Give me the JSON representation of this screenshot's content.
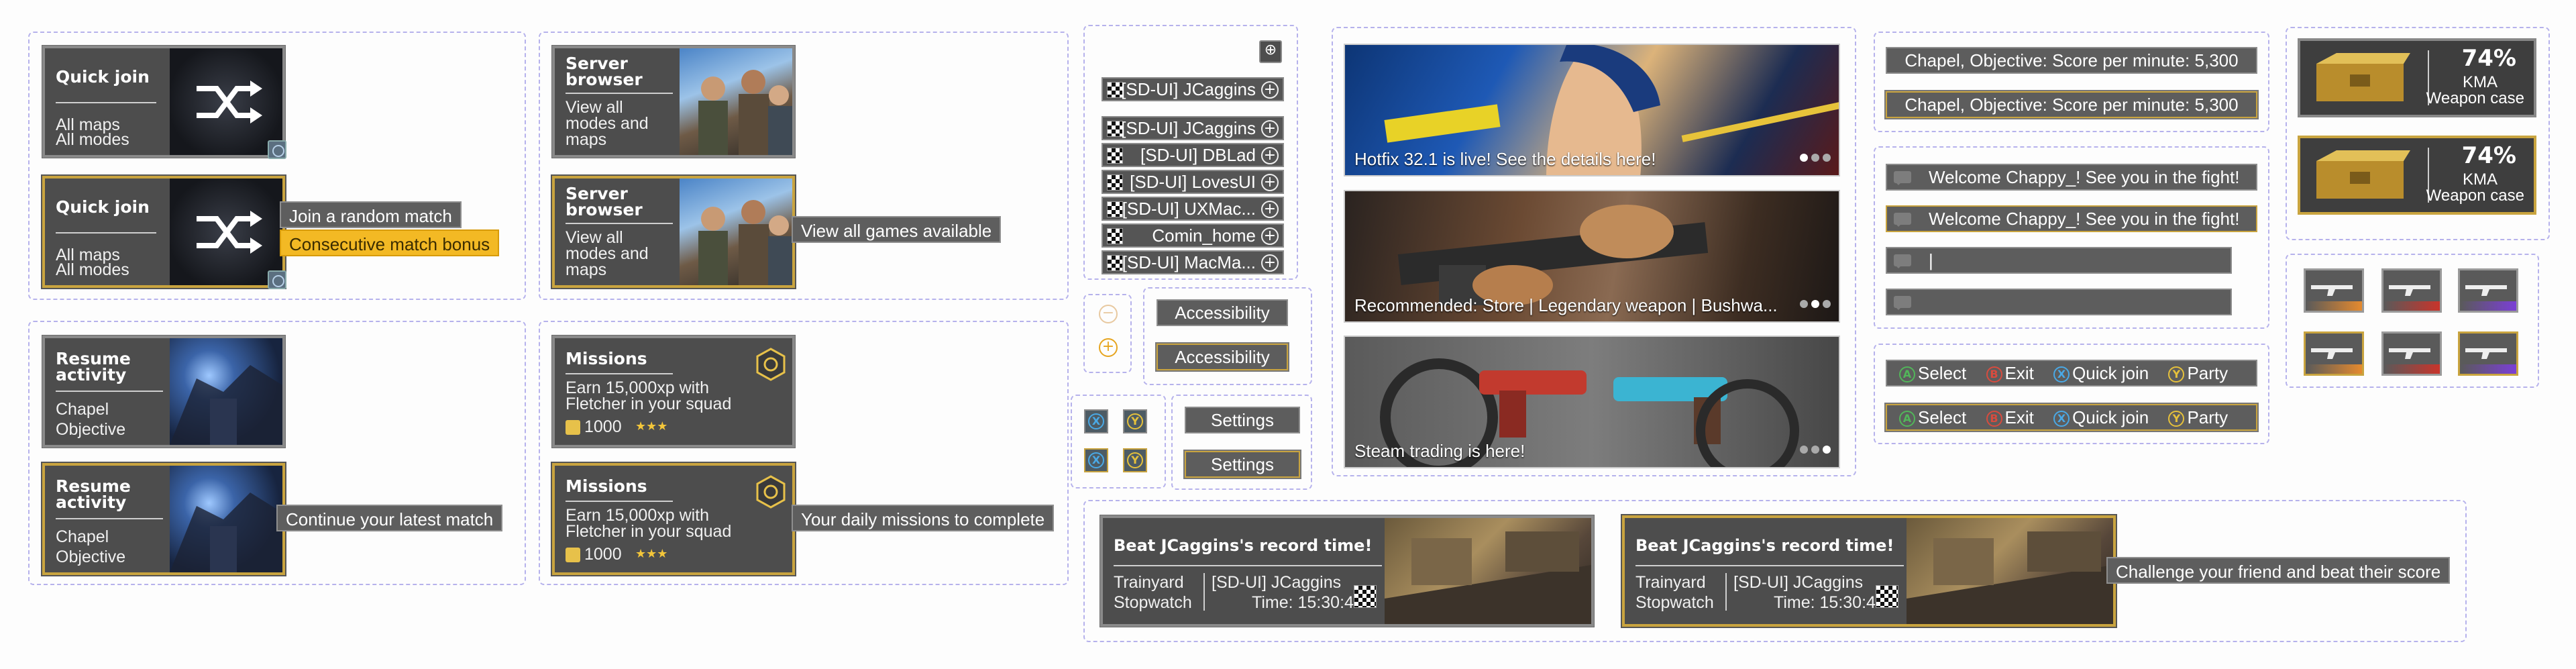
{
  "quick_join": {
    "title": "Quick join",
    "line1": "All maps",
    "line2": "All modes",
    "tip": "Join a random match",
    "bonus": "Consecutive match bonus"
  },
  "server_browser": {
    "title_l1": "Server",
    "title_l2": "browser",
    "sub_l1": "View all",
    "sub_l2": "modes and",
    "sub_l3": "maps",
    "tip": "View all games available"
  },
  "resume": {
    "title_l1": "Resume",
    "title_l2": "activity",
    "line1": "Chapel",
    "line2": "Objective",
    "tip": "Continue your latest match"
  },
  "missions": {
    "title": "Missions",
    "line1": "Earn 15,000xp with",
    "line2": "Fletcher in your squad",
    "reward": "1000",
    "stars": "★★★",
    "tip": "Your daily missions to complete"
  },
  "friends": {
    "list": [
      "[SD-UI] JCaggins",
      "[SD-UI] JCaggins",
      "[SD-UI] DBLad",
      "[SD-UI] LovesUI",
      "[SD-UI] UXMac...",
      "Comin_home",
      "[SD-UI] MacMa..."
    ]
  },
  "buttons": {
    "accessibility": "Accessibility",
    "settings": "Settings"
  },
  "banners": [
    {
      "caption": "Hotfix 32.1 is live! See the details here!"
    },
    {
      "caption": "Recommended: Store | Legendary weapon | Bushwa..."
    },
    {
      "caption": "Steam trading is here!"
    }
  ],
  "score_bars": [
    "Chapel, Objective: Score per minute: 5,300",
    "Chapel, Objective: Score per minute: 5,300"
  ],
  "chat": {
    "welcome": "Welcome Chappy_! See you in the fight!",
    "input_value": "|"
  },
  "hints": {
    "A": "A",
    "B": "B",
    "X": "X",
    "Y": "Y",
    "select": "Select",
    "exit": "Exit",
    "quick_join": "Quick join",
    "party": "Party"
  },
  "record": {
    "title": "Beat JCaggins's record time!",
    "map": "Trainyard",
    "mode": "Stopwatch",
    "player": "[SD-UI] JCaggins",
    "time": "Time: 15:30:42",
    "tip": "Challenge your friend and beat their score"
  },
  "weapon_case": {
    "percent": "74%",
    "brand": "KMA",
    "name": "Weapon case"
  },
  "colors": {
    "accent_gold": "#c9a43f",
    "bonus_yellow": "#f3b924",
    "panel": "#4d4d4d",
    "dash": "#b6b2ec"
  }
}
